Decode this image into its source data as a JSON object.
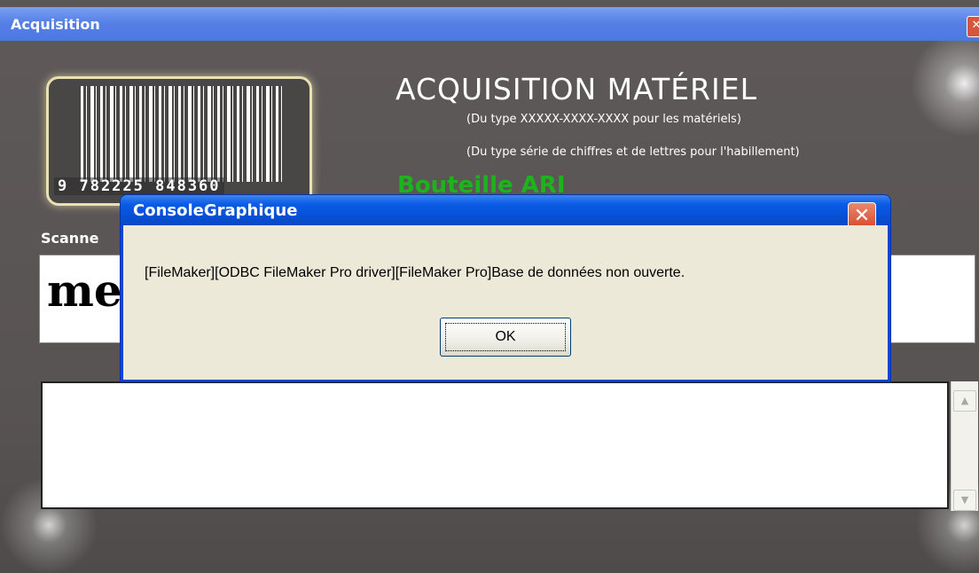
{
  "main_window": {
    "title": "Acquisition",
    "heading": "ACQUISITION MATÉRIEL",
    "hint_material": "(Du type XXXXX-XXXX-XXXX pour les matériels)",
    "hint_clothing": "(Du type série de chiffres et de lettres pour l'habillement)",
    "partial_green_text": "Bouteille ARI",
    "scan_label": "Scanne",
    "scan_value": "me",
    "barcode_number": "9 782225 848360"
  },
  "dialog": {
    "title": "ConsoleGraphique",
    "message": "[FileMaker][ODBC FileMaker Pro driver][FileMaker Pro]Base de données non ouverte.",
    "ok_label": "OK",
    "close_glyph": "✕"
  },
  "icons": {
    "main_close": "✕",
    "scroll_up": "▲",
    "scroll_down": "▼"
  },
  "colors": {
    "titlebar_blue": "#0a46d8",
    "green_text": "#1eb21e",
    "close_red": "#d3462a"
  }
}
